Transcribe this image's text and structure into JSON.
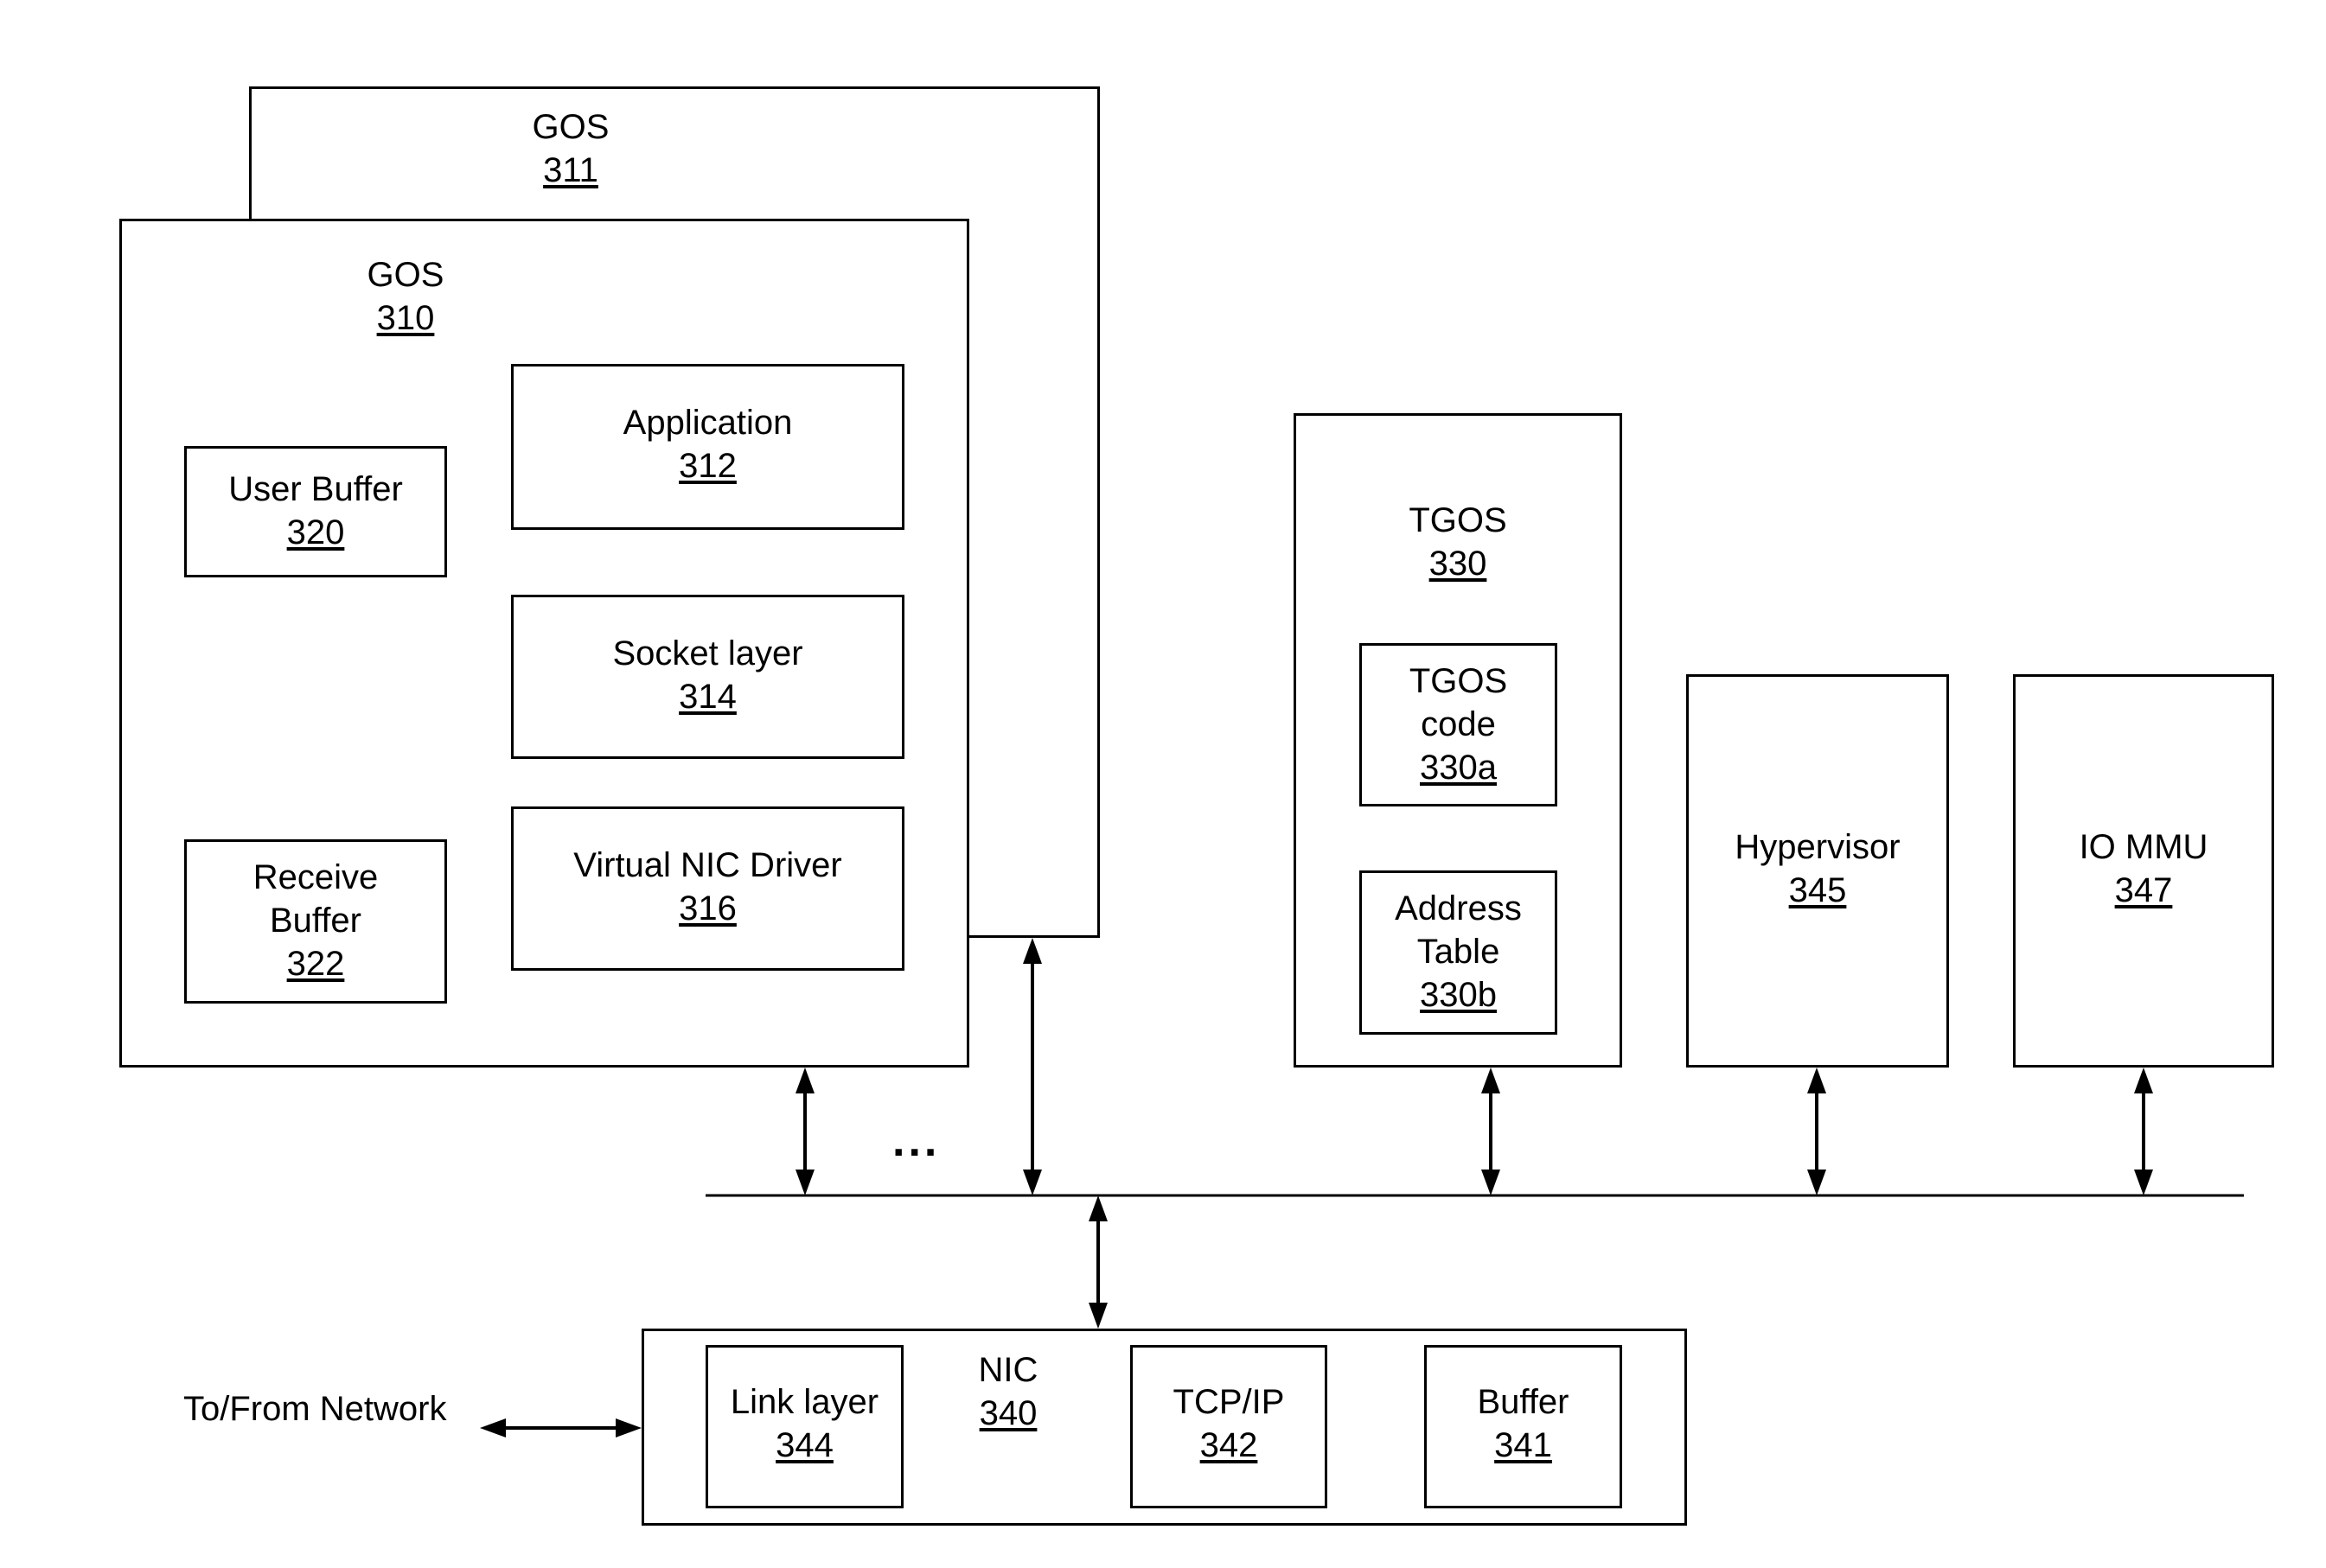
{
  "diagram": {
    "gos311": {
      "title": "GOS",
      "ref": "311"
    },
    "gos310": {
      "title": "GOS",
      "ref": "310"
    },
    "application": {
      "title": "Application",
      "ref": "312"
    },
    "user_buffer": {
      "title": "User Buffer",
      "ref": "320"
    },
    "socket_layer": {
      "title": "Socket layer",
      "ref": "314"
    },
    "receive_buffer": {
      "title1": "Receive",
      "title2": "Buffer",
      "ref": "322"
    },
    "vnic_driver": {
      "title": "Virtual NIC Driver",
      "ref": "316"
    },
    "tgos": {
      "title": "TGOS",
      "ref": "330"
    },
    "tgos_code": {
      "title1": "TGOS",
      "title2": "code",
      "ref": "330a"
    },
    "address_table": {
      "title1": "Address",
      "title2": "Table",
      "ref": "330b"
    },
    "hypervisor": {
      "title": "Hypervisor",
      "ref": "345"
    },
    "iommu": {
      "title": "IO MMU",
      "ref": "347"
    },
    "nic": {
      "title": "NIC",
      "ref": "340"
    },
    "link_layer": {
      "title": "Link layer",
      "ref": "344"
    },
    "tcpip": {
      "title": "TCP/IP",
      "ref": "342"
    },
    "buffer": {
      "title": "Buffer",
      "ref": "341"
    },
    "network_label": "To/From Network",
    "ellipsis": "..."
  }
}
